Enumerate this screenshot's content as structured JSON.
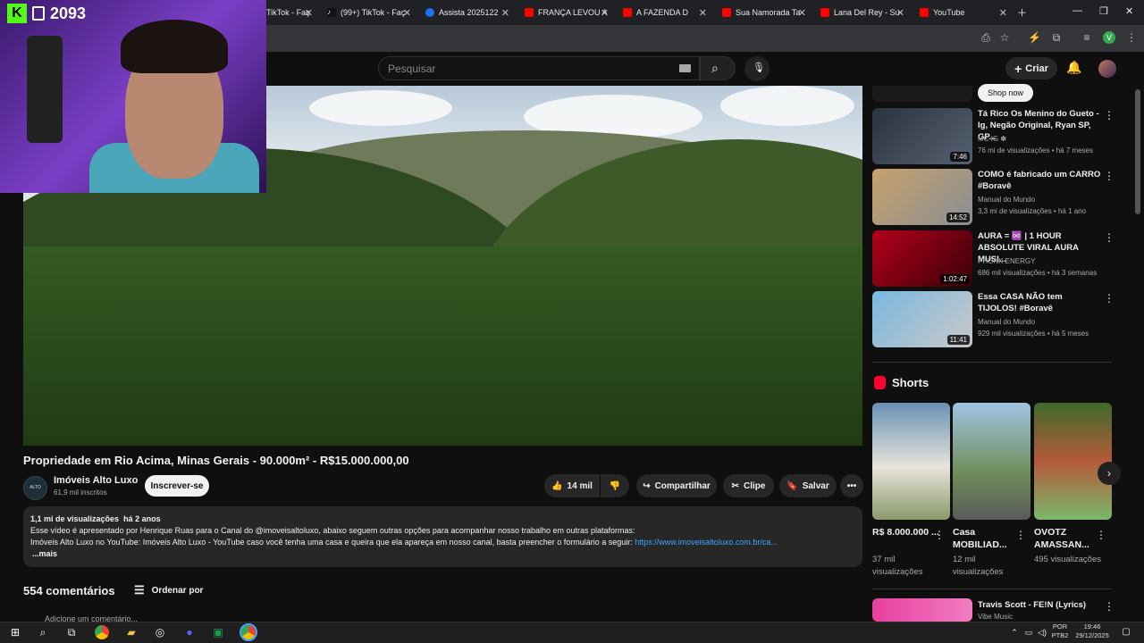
{
  "browser": {
    "tabs": [
      {
        "label": "TikTok - Faç",
        "color": "#111"
      },
      {
        "label": "(99+) TikTok - Faç",
        "color": "#111"
      },
      {
        "label": "Assista 2025122",
        "color": "#1a73e8"
      },
      {
        "label": "FRANÇA LEVOU A",
        "color": "#ff0000"
      },
      {
        "label": "A FAZENDA D",
        "color": "#ff0000"
      },
      {
        "label": "Sua Namorada Ta",
        "color": "#ff0000"
      },
      {
        "label": "Lana Del Rey - Su",
        "color": "#ff0000"
      },
      {
        "label": "YouTube",
        "color": "#ff0000"
      }
    ]
  },
  "stream": {
    "viewer_count": "2093"
  },
  "youtube": {
    "search_placeholder": "Pesquisar",
    "create_label": "Criar"
  },
  "video": {
    "title": "Propriedade em Rio Acima, Minas Gerais - 90.000m² - R$15.000.000,00",
    "channel_name": "Imóveis Alto Luxo",
    "channel_subs": "61,9 mil inscritos",
    "channel_avatar_text": "ALTO LUXO",
    "subscribe_label": "Inscrever-se",
    "likes": "14 mil",
    "share_label": "Compartilhar",
    "clip_label": "Clipe",
    "save_label": "Salvar",
    "views": "1,1 mi de visualizações",
    "age": "há 2 anos",
    "desc_line1": "Esse vídeo é apresentado por Henrique Ruas para o Canal do @imoveisaltoluxo, abaixo seguem outras opções para acompanhar nosso trabalho em outras plataformas:",
    "desc_line2": "Imóveis Alto Luxo no YouTube: Imóveis Alto Luxo - YouTube caso você tenha uma casa e queira que ela apareça em nosso canal, basta preencher o formulário a seguir:",
    "desc_link": "https://www.imoveisaltoluxo.com.br/ca...",
    "more_label": "...mais"
  },
  "comments": {
    "count_label": "554 comentários",
    "sort_label": "Ordenar por",
    "add_placeholder": "Adicione um comentário..."
  },
  "sidebar": {
    "shop_now": "Shop now",
    "items": [
      {
        "title": "Tá Rico Os Menino do Gueto - Ig, Negão Original, Ryan SP, GP...",
        "channel": "MC IG ✽",
        "meta": "76 mi de visualizações • há 7 meses",
        "duration": "7:46"
      },
      {
        "title": "COMO é fabricado um CARRO #Boravê",
        "channel": "Manual do Mundo",
        "meta": "3,3 mi de visualizações • há 1 ano",
        "duration": "14:52"
      },
      {
        "title": "AURA = ♾️ | 1 HOUR ABSOLUTE VIRAL AURA MUSI...",
        "channel": "PHONK ENERGY",
        "meta": "686 mil visualizações • há 3 semanas",
        "duration": "1:02:47"
      },
      {
        "title": "Essa CASA NÃO tem TIJOLOS! #Boravê",
        "channel": "Manual do Mundo",
        "meta": "929 mil visualizações • há 5 meses",
        "duration": "11:41"
      }
    ],
    "shorts_label": "Shorts",
    "shorts": [
      {
        "title": "R$ 8.000.000 ...",
        "views": "37 mil visualizações"
      },
      {
        "title": "Casa MOBILIAD...",
        "views": "12 mil visualizações"
      },
      {
        "title": "OVOTZ AMASSAN...",
        "views": "495 visualizações"
      }
    ],
    "last_item": {
      "title": "Travis Scott - FE!N (Lyrics)",
      "channel": "Vibe Music"
    }
  },
  "taskbar": {
    "lang": "POR",
    "layout": "PTB2",
    "time": "19:46",
    "date": "29/12/2025"
  }
}
